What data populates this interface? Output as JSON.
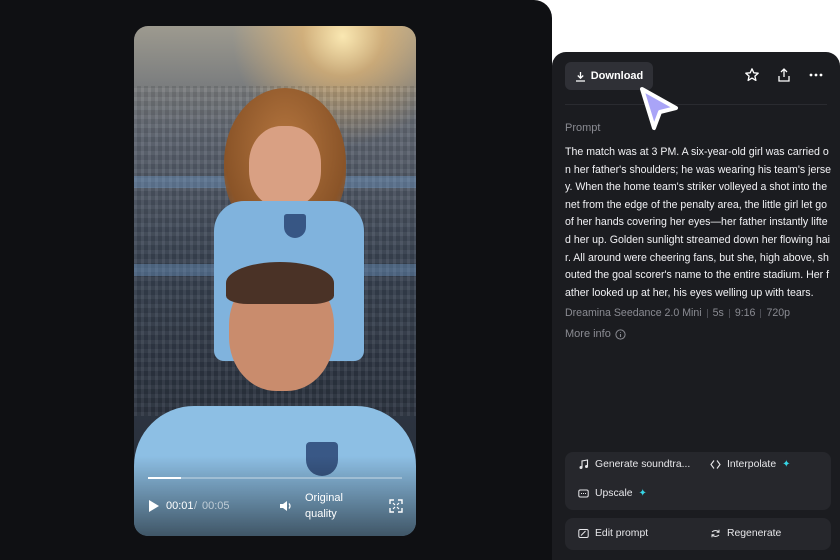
{
  "player": {
    "current_time": "00:01",
    "separator": "/",
    "total_time": "00:05",
    "quality_label": "Original quality",
    "progress_fraction": 0.13
  },
  "toolbar": {
    "download_label": "Download"
  },
  "details": {
    "prompt_heading": "Prompt",
    "prompt_text": "The match was at 3 PM. A six-year-old girl was carried on her father's shoulders; he was wearing his team's jersey. When the home team's striker volleyed a shot into the net from the edge of the penalty area, the little girl let go of her hands covering her eyes—her father instantly lifted her up. Golden sunlight streamed down her flowing hair. All around were cheering fans, but she, high above, shouted the goal scorer's name to the entire stadium. Her father looked up at her, his eyes welling up with tears.",
    "model": "Dreamina Seedance 2.0 Mini",
    "duration": "5s",
    "aspect_ratio": "9:16",
    "resolution": "720p",
    "more_info_label": "More info"
  },
  "tools": {
    "generate_soundtrack": "Generate soundtra...",
    "interpolate": "Interpolate",
    "upscale": "Upscale",
    "edit_prompt": "Edit prompt",
    "regenerate": "Regenerate"
  },
  "colors": {
    "accent_sparkle": "#37d6e6",
    "cursor": "#a9a4f7",
    "panel_bg": "#1b1c20",
    "main_bg": "#0f1013"
  }
}
